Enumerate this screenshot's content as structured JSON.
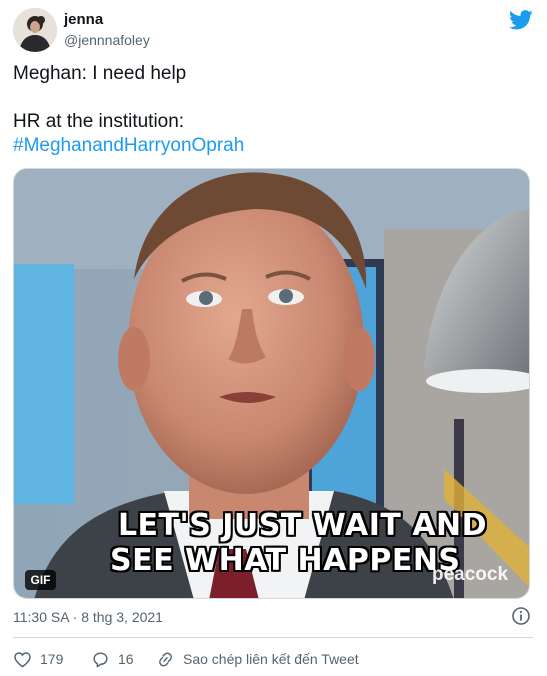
{
  "author": {
    "display_name": "jenna",
    "handle": "@jennnafoley"
  },
  "tweet": {
    "line1": "Meghan: I need help",
    "line2": "HR at the institution:",
    "hashtag": "#MeghanandHarryonOprah"
  },
  "media": {
    "caption_line1": "LET'S JUST WAIT AND",
    "caption_line2": "SEE WHAT HAPPENS",
    "watermark": "peacock",
    "badge": "GIF"
  },
  "timestamp": "11:30 SA · 8 thg 3, 2021",
  "actions": {
    "likes": "179",
    "replies": "16",
    "copy_link_label": "Sao chép liên kết đến Tweet"
  },
  "colors": {
    "accent": "#1d9bf0",
    "text": "#0f1419",
    "muted": "#536471"
  },
  "icons": [
    "twitter-bird-icon",
    "info-icon",
    "heart-icon",
    "reply-icon",
    "link-icon"
  ]
}
